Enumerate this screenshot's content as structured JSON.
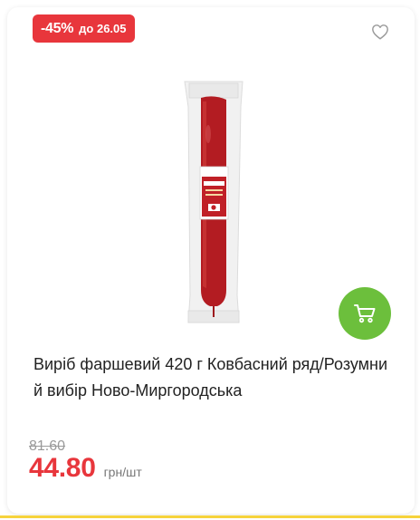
{
  "badge": {
    "discount": "-45%",
    "until": "до 26.05"
  },
  "icons": {
    "favorite": "heart-outline-icon",
    "cart": "cart-icon"
  },
  "product": {
    "title": "Виріб фаршевий 420 г Ковбасний ряд/Розумний вибір Ново-Миргородська",
    "package_label": "НОВО-МИРГОРОДСЬКА"
  },
  "price": {
    "old": "81.60",
    "current": "44.80",
    "unit": "грн/шт"
  },
  "colors": {
    "accent_red": "#e8363c",
    "cart_green": "#6cbf3c",
    "bottom_yellow": "#f6d33c"
  }
}
